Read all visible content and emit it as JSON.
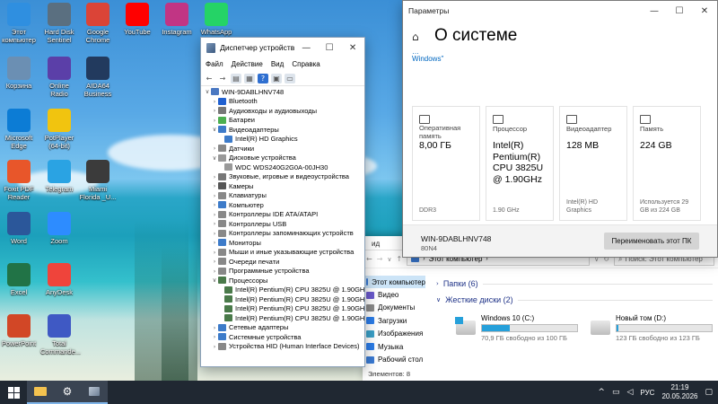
{
  "desktop": {
    "icons": [
      {
        "label": "Этот компьютер",
        "icon": "computer-icon",
        "color": "#2f8fe0"
      },
      {
        "label": "Hard Disk Sentinel",
        "icon": "disk-icon",
        "color": "#5a6f80"
      },
      {
        "label": "Google Chrome",
        "icon": "chrome-icon",
        "color": "#db4437"
      },
      {
        "label": "YouTube",
        "icon": "youtube-icon",
        "color": "#ff0000"
      },
      {
        "label": "Instagram",
        "icon": "instagram-icon",
        "color": "#c13584"
      },
      {
        "label": "WhatsApp",
        "icon": "whatsapp-icon",
        "color": "#25d366"
      },
      {
        "label": "Корзина",
        "icon": "recycle-bin-icon",
        "color": "#6b8fb3"
      },
      {
        "label": "Online Radio",
        "icon": "radio-icon",
        "color": "#5b3fa8"
      },
      {
        "label": "AIDA64 Business",
        "icon": "aida64-icon",
        "color": "#223a5e"
      },
      {
        "label": "Microsoft Edge",
        "icon": "edge-icon",
        "color": "#0c7cd5"
      },
      {
        "label": "PotPlayer (64-bit)",
        "icon": "potplayer-icon",
        "color": "#f1c40f"
      },
      {
        "label": "Foxit PDF Reader",
        "icon": "foxit-icon",
        "color": "#e8562a"
      },
      {
        "label": "Telegram",
        "icon": "telegram-icon",
        "color": "#2aa3e3"
      },
      {
        "label": "Miami Florida _U...",
        "icon": "video-icon",
        "color": "#3b3b3b"
      },
      {
        "label": "Word",
        "icon": "word-icon",
        "color": "#2b579a"
      },
      {
        "label": "Zoom",
        "icon": "zoom-icon",
        "color": "#2d8cff"
      },
      {
        "label": "Excel",
        "icon": "excel-icon",
        "color": "#217346"
      },
      {
        "label": "AnyDesk",
        "icon": "anydesk-icon",
        "color": "#ef443b"
      },
      {
        "label": "PowerPoint",
        "icon": "powerpoint-icon",
        "color": "#d24726"
      },
      {
        "label": "Total Commande...",
        "icon": "total-commander-icon",
        "color": "#3f59c4"
      }
    ]
  },
  "devmgr": {
    "title": "Диспетчер устройств",
    "menu": [
      "Файл",
      "Действие",
      "Вид",
      "Справка"
    ],
    "tree": [
      {
        "label": "WIN-9DABLHNV748",
        "depth": 0,
        "arrow": "v",
        "color": "#4a78c2"
      },
      {
        "label": "Bluetooth",
        "depth": 1,
        "arrow": ">",
        "color": "#2060d0"
      },
      {
        "label": "Аудиовходы и аудиовыходы",
        "depth": 1,
        "arrow": ">",
        "color": "#777"
      },
      {
        "label": "Батареи",
        "depth": 1,
        "arrow": ">",
        "color": "#4caf50"
      },
      {
        "label": "Видеоадаптеры",
        "depth": 1,
        "arrow": "v",
        "color": "#3d7bc9"
      },
      {
        "label": "Intel(R) HD Graphics",
        "depth": 2,
        "arrow": "",
        "color": "#3d7bc9"
      },
      {
        "label": "Датчики",
        "depth": 1,
        "arrow": ">",
        "color": "#888"
      },
      {
        "label": "Дисковые устройства",
        "depth": 1,
        "arrow": "v",
        "color": "#999"
      },
      {
        "label": "WDC WDS240G2G0A-00JH30",
        "depth": 2,
        "arrow": "",
        "color": "#999"
      },
      {
        "label": "Звуковые, игровые и видеоустройства",
        "depth": 1,
        "arrow": ">",
        "color": "#777"
      },
      {
        "label": "Камеры",
        "depth": 1,
        "arrow": ">",
        "color": "#555"
      },
      {
        "label": "Клавиатуры",
        "depth": 1,
        "arrow": ">",
        "color": "#888"
      },
      {
        "label": "Компьютер",
        "depth": 1,
        "arrow": ">",
        "color": "#3d7bc9"
      },
      {
        "label": "Контроллеры IDE ATA/ATAPI",
        "depth": 1,
        "arrow": ">",
        "color": "#888"
      },
      {
        "label": "Контроллеры USB",
        "depth": 1,
        "arrow": ">",
        "color": "#888"
      },
      {
        "label": "Контроллеры запоминающих устройств",
        "depth": 1,
        "arrow": ">",
        "color": "#888"
      },
      {
        "label": "Мониторы",
        "depth": 1,
        "arrow": ">",
        "color": "#3d7bc9"
      },
      {
        "label": "Мыши и иные указывающие устройства",
        "depth": 1,
        "arrow": ">",
        "color": "#888"
      },
      {
        "label": "Очереди печати",
        "depth": 1,
        "arrow": ">",
        "color": "#888"
      },
      {
        "label": "Программные устройства",
        "depth": 1,
        "arrow": ">",
        "color": "#888"
      },
      {
        "label": "Процессоры",
        "depth": 1,
        "arrow": "v",
        "color": "#4a7a4a"
      },
      {
        "label": "Intel(R) Pentium(R) CPU 3825U @ 1.90GHz",
        "depth": 2,
        "arrow": "",
        "color": "#4a7a4a"
      },
      {
        "label": "Intel(R) Pentium(R) CPU 3825U @ 1.90GHz",
        "depth": 2,
        "arrow": "",
        "color": "#4a7a4a"
      },
      {
        "label": "Intel(R) Pentium(R) CPU 3825U @ 1.90GHz",
        "depth": 2,
        "arrow": "",
        "color": "#4a7a4a"
      },
      {
        "label": "Intel(R) Pentium(R) CPU 3825U @ 1.90GHz",
        "depth": 2,
        "arrow": "",
        "color": "#4a7a4a"
      },
      {
        "label": "Сетевые адаптеры",
        "depth": 1,
        "arrow": ">",
        "color": "#3d7bc9"
      },
      {
        "label": "Системные устройства",
        "depth": 1,
        "arrow": ">",
        "color": "#3d7bc9"
      },
      {
        "label": "Устройства HID (Human Interface Devices)",
        "depth": 1,
        "arrow": ">",
        "color": "#888"
      }
    ]
  },
  "settings": {
    "title": "Параметры",
    "page_title": "О системе",
    "clipped_text_1": "…",
    "clipped_text_2": "Windows\"",
    "cards": [
      {
        "label": "Оперативная память",
        "value": "8,00 ГБ",
        "sub": "DDR3",
        "icon": "ram-icon"
      },
      {
        "label": "Процессор",
        "value": "Intel(R) Pentium(R) CPU 3825U @ 1.90GHz",
        "sub": "1.90 GHz",
        "icon": "cpu-icon"
      },
      {
        "label": "Видеоадаптер",
        "value": "128 MB",
        "sub": "Intel(R) HD Graphics",
        "icon": "gpu-icon"
      },
      {
        "label": "Память",
        "value": "224 GB",
        "sub": "Используется 29 GB из 224 GB",
        "icon": "storage-icon"
      }
    ],
    "device_name": "WIN-9DABLHNV748",
    "device_model": "80N4",
    "rename_button": "Переименовать этот ПК"
  },
  "explorer": {
    "tabs": [
      "ид"
    ],
    "address": "Этот компьютер",
    "search_placeholder": "Поиск: Этот компьютер",
    "nav": [
      {
        "label": "Этот компьютер",
        "color": "#3a7bd5",
        "selected": true
      },
      {
        "label": "Видео",
        "color": "#6a5acd",
        "selected": false
      },
      {
        "label": "Документы",
        "color": "#8a8a8a",
        "selected": false
      },
      {
        "label": "Загрузки",
        "color": "#2b7de9",
        "selected": false
      },
      {
        "label": "Изображения",
        "color": "#3aa0c8",
        "selected": false
      },
      {
        "label": "Музыка",
        "color": "#2b7de9",
        "selected": false
      },
      {
        "label": "Рабочий стол",
        "color": "#3a7bd5",
        "selected": false
      }
    ],
    "group_folders": "Папки (6)",
    "group_drives": "Жесткие диски (2)",
    "drives": [
      {
        "name": "Windows 10 (C:)",
        "free": "70,9 ГБ свободно из 100 ГБ",
        "used_fraction": 0.29
      },
      {
        "name": "Новый том (D:)",
        "free": "123 ГБ свободно из 123 ГБ",
        "used_fraction": 0.01
      }
    ],
    "status": "Элементов: 8"
  },
  "taskbar": {
    "lang": "РУС",
    "time": "21:19",
    "date": "20.05.2026"
  }
}
